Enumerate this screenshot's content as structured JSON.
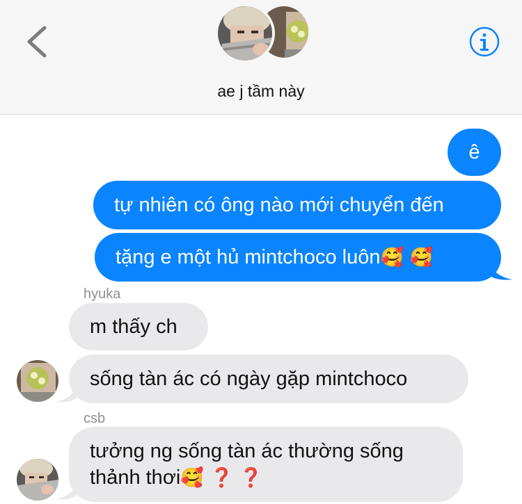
{
  "header": {
    "group_name": "ae j tầm này",
    "back_icon": "chevron-left-icon",
    "info_icon": "info-icon",
    "accent_color": "#0a84ff"
  },
  "messages": [
    {
      "direction": "outgoing",
      "text": "ê"
    },
    {
      "direction": "outgoing",
      "text": "tự nhiên có ông nào mới chuyển đến"
    },
    {
      "direction": "outgoing",
      "text": "tặng e một hủ mintchoco luôn",
      "emoji": "🥰 🥰"
    },
    {
      "direction": "incoming",
      "sender": "hyuka",
      "text": "m thấy ch"
    },
    {
      "direction": "incoming",
      "text": "sống tàn ác có ngày gặp mintchoco"
    },
    {
      "direction": "incoming",
      "sender": "csb",
      "line1": "tưởng ng sống tàn ác thường sống",
      "line2": "thảnh thơi",
      "emoji": "🥰 ❓ ❓"
    }
  ],
  "colors": {
    "outgoing_bubble": "#0a84ff",
    "incoming_bubble": "#e9e9eb",
    "header_background": "#f6f6f6"
  }
}
